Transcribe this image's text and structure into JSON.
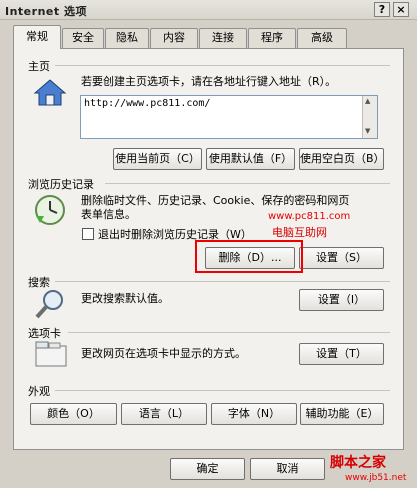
{
  "window": {
    "title": "Internet 选项",
    "help_label": "?",
    "close_label": "×"
  },
  "tabs": [
    {
      "label": "常规"
    },
    {
      "label": "安全"
    },
    {
      "label": "隐私"
    },
    {
      "label": "内容"
    },
    {
      "label": "连接"
    },
    {
      "label": "程序"
    },
    {
      "label": "高级"
    }
  ],
  "home": {
    "section_title": "主页",
    "description": "若要创建主页选项卡，请在各地址行键入地址（R）。",
    "url": "http://www.pc811.com/",
    "use_current_label": "使用当前页（C）",
    "use_default_label": "使用默认值（F）",
    "use_blank_label": "使用空白页（B）"
  },
  "history": {
    "section_title": "浏览历史记录",
    "description_line1": "删除临时文件、历史记录、Cookie、保存的密码和网页",
    "description_line2": "表单信息。",
    "checkbox_label": "退出时删除浏览历史记录（W）",
    "delete_label": "删除（D）...",
    "settings_label": "设置（S）"
  },
  "search": {
    "section_title": "搜索",
    "description": "更改搜索默认值。",
    "settings_label": "设置（I）"
  },
  "tabs_section": {
    "section_title": "选项卡",
    "description": "更改网页在选项卡中显示的方式。",
    "settings_label": "设置（T）"
  },
  "appearance": {
    "section_title": "外观",
    "colors_label": "颜色（O）",
    "languages_label": "语言（L）",
    "fonts_label": "字体（N）",
    "accessibility_label": "辅助功能（E）"
  },
  "footer": {
    "ok_label": "确定",
    "cancel_label": "取消"
  },
  "watermarks": {
    "site_url": "www.pc811.com",
    "site_name": "电脑互助网",
    "corner_logo": "脚本之家",
    "corner_url": "www.jb51.net"
  },
  "colors": {
    "highlight": "#e00000",
    "accent_blue": "#2a5db0"
  }
}
